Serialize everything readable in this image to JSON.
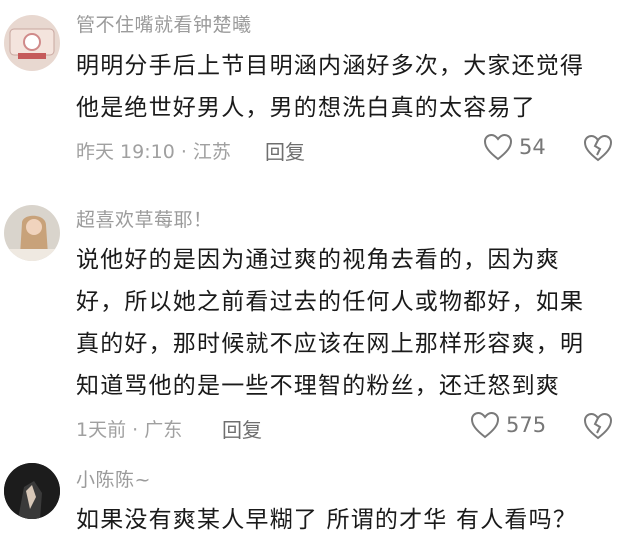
{
  "comments": [
    {
      "username": "管不住嘴就看钟楚曦",
      "lines": [
        "明明分手后上节目明涵内涵好多次，大家还觉得",
        "他是绝世好男人，男的想洗白真的太容易了"
      ],
      "time_location": "昨天 19:10 · 江苏",
      "reply_label": "回复",
      "likes": "54"
    },
    {
      "username": "超喜欢草莓耶！",
      "lines": [
        "说他好的是因为通过爽的视角去看的，因为爽",
        "好，所以她之前看过去的任何人或物都好，如果",
        "真的好，那时候就不应该在网上那样形容爽，明",
        "知道骂他的是一些不理智的粉丝，还迁怒到爽"
      ],
      "time_location": "1天前 · 广东",
      "reply_label": "回复",
      "likes": "575"
    },
    {
      "username": "小陈陈~",
      "lines": [
        "如果没有爽某人早糊了 所谓的才华 有人看吗？"
      ]
    }
  ]
}
